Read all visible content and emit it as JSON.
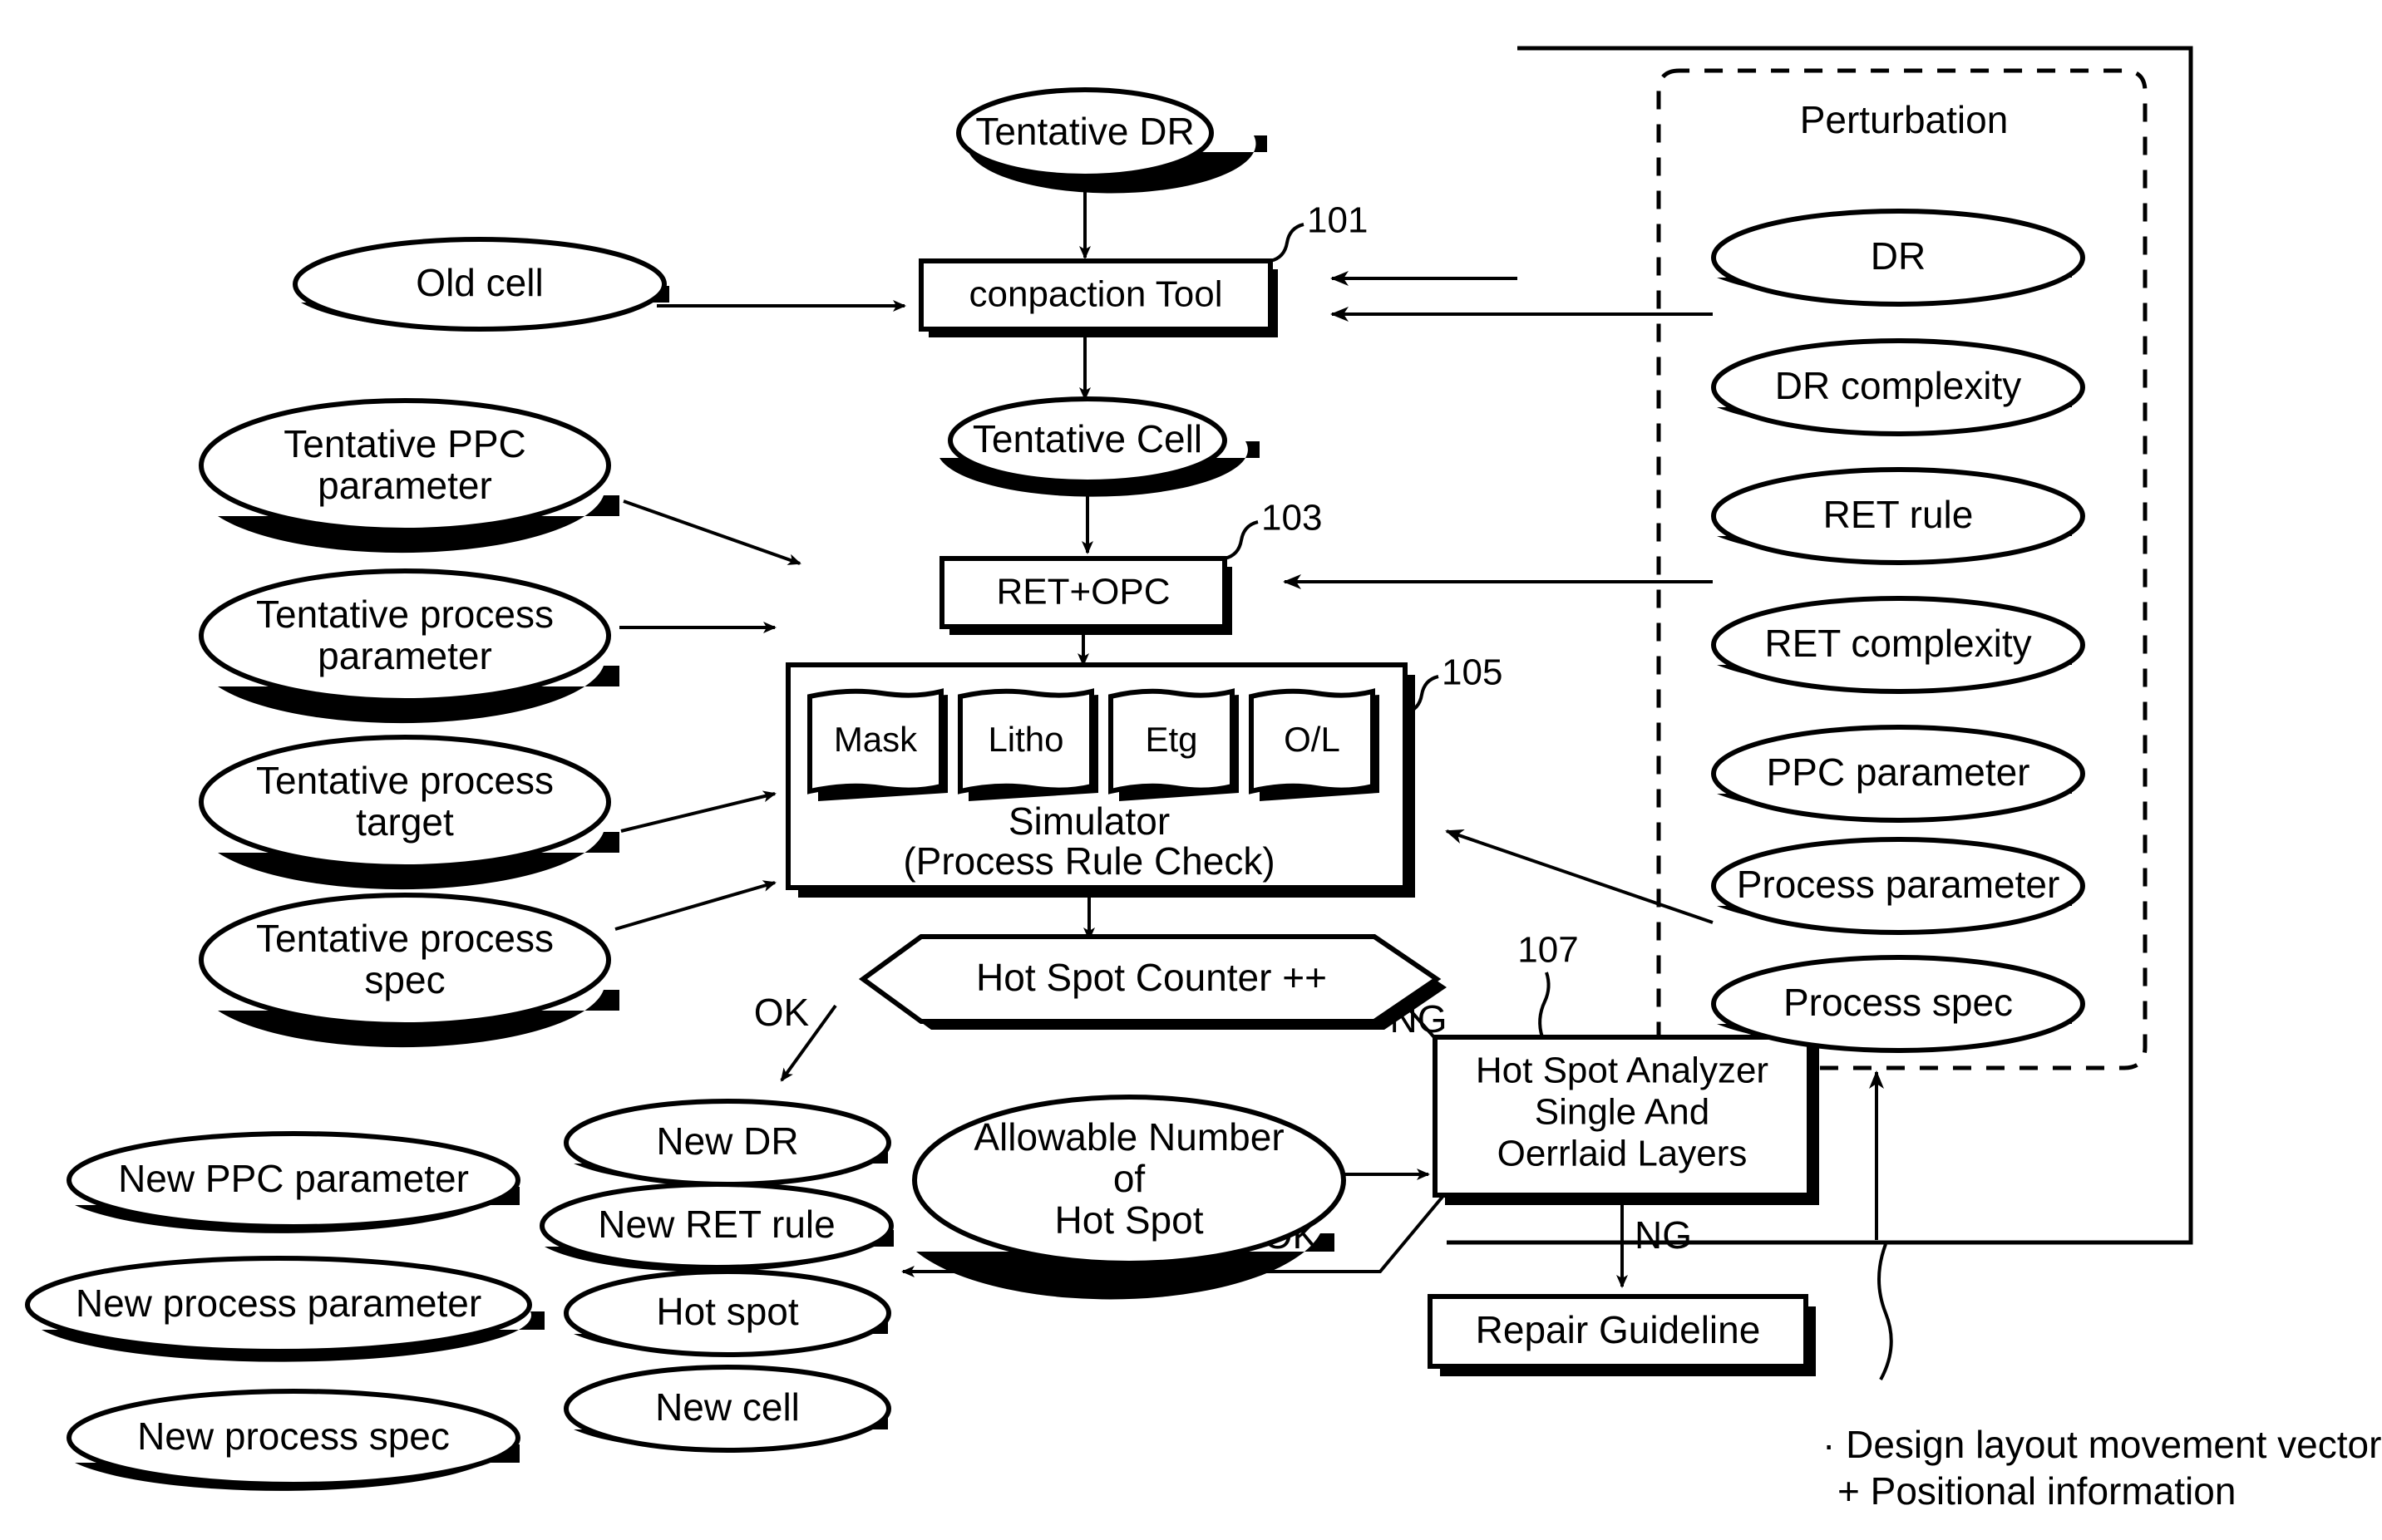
{
  "figure": {
    "type": "flowchart",
    "description": "Patent-style process flow diagram for design rule / layout compaction with hot spot analysis"
  },
  "reference_numerals": {
    "compaction_tool": "101",
    "ret_opc": "103",
    "simulator": "105",
    "hot_spot_analyzer": "107"
  },
  "main_flow": {
    "tentative_dr": "Tentative DR",
    "compaction_tool": "conpaction Tool",
    "tentative_cell": "Tentative Cell",
    "ret_opc": "RET+OPC",
    "simulator_line1": "Simulator",
    "simulator_line2": "(Process Rule Check)",
    "simulator_tabs": [
      "Mask",
      "Litho",
      "Etg",
      "O/L"
    ],
    "hot_spot_counter": "Hot Spot Counter ++",
    "hot_spot_analyzer_line1": "Hot Spot Analyzer",
    "hot_spot_analyzer_line2": "Single And",
    "hot_spot_analyzer_line3": "Oerrlaid Layers",
    "repair_guideline": "Repair Guideline",
    "allowable_number_line1": "Allowable Number",
    "allowable_number_line2": "of",
    "allowable_number_line3": "Hot Spot"
  },
  "edge_labels": {
    "counter_ok": "OK",
    "counter_ng": "NG",
    "analyzer_ng": "NG",
    "analyzer_ok": "OK"
  },
  "inputs_left": [
    {
      "label": "Old cell",
      "lines": [
        "Old cell"
      ]
    },
    {
      "label": "Tentative PPC parameter",
      "lines": [
        "Tentative PPC",
        "parameter"
      ]
    },
    {
      "label": "Tentative process parameter",
      "lines": [
        "Tentative process",
        "parameter"
      ]
    },
    {
      "label": "Tentative process target",
      "lines": [
        "Tentative process",
        "target"
      ]
    },
    {
      "label": "Tentative process spec",
      "lines": [
        "Tentative process",
        "spec"
      ]
    }
  ],
  "perturbation": {
    "title": "Perturbation",
    "items": [
      "DR",
      "DR complexity",
      "RET rule",
      "RET complexity",
      "PPC parameter",
      "Process parameter",
      "Process spec"
    ]
  },
  "outputs_left": [
    "New PPC parameter",
    "New process parameter",
    "New process spec"
  ],
  "outputs_mid": [
    "New DR",
    "New RET rule",
    "Hot spot",
    "New cell"
  ],
  "annotation": {
    "line1": "· Design layout movement vector",
    "line2": "+ Positional information"
  },
  "colors": {
    "ink": "#000000",
    "paper": "#ffffff"
  }
}
